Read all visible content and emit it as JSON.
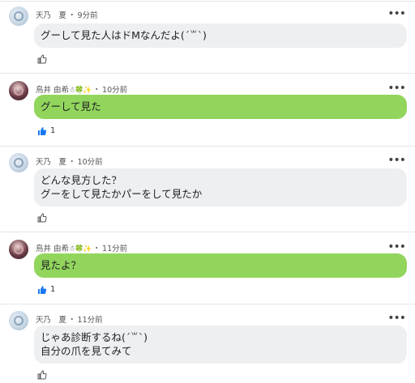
{
  "comments": [
    {
      "user": "天乃　夏",
      "time": "9分前",
      "lines": [
        "グーして見た人はドMなんだよ(ˊ꒳ˋ)"
      ],
      "like_count": "",
      "liked": false,
      "bubble_color": "#eeeff1"
    },
    {
      "user": "鳥井 由希",
      "user_emojis": "☃🍀✨",
      "time": "10分前",
      "lines": [
        "グーして見た"
      ],
      "like_count": "1",
      "liked": true,
      "bubble_color": "#92d55d"
    },
    {
      "user": "天乃　夏",
      "time": "10分前",
      "lines": [
        "どんな見方した？",
        "グーをして見たかパーをして見たか"
      ],
      "like_count": "",
      "liked": false,
      "bubble_color": "#eeeff1"
    },
    {
      "user": "鳥井 由希",
      "user_emojis": "☃🍀✨",
      "time": "11分前",
      "lines": [
        "見たよ？"
      ],
      "like_count": "1",
      "liked": true,
      "bubble_color": "#92d55d"
    },
    {
      "user": "天乃　夏",
      "time": "11分前",
      "lines": [
        "じゃあ診断するね(ˊ꒳ˋ)",
        "自分の爪を見てみて"
      ],
      "like_count": "",
      "liked": false,
      "bubble_color": "#eeeff1"
    }
  ],
  "ui": {
    "separator": "・",
    "more_symbol": "•••",
    "icons": {
      "avatar": "avatar-icon",
      "more": "more-options-icon",
      "like": "thumbs-up-icon"
    },
    "colors": {
      "liked": "#1877f2",
      "unliked": "#666666"
    }
  }
}
